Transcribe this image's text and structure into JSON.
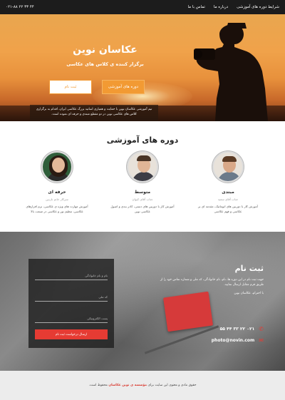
{
  "topbar": {
    "nav": [
      "شرایط دوره های آموزشی",
      "درباره ما",
      "تماس با ما"
    ],
    "phone": "۰۲۱-۸۸ ۲۲ ۳۳ ۴۴"
  },
  "hero": {
    "title": "عکاسان نوین",
    "subtitle": "برگزار کننده ی کلاس های عکاسی",
    "btn_courses": "دوره های آموزشی",
    "btn_register": "ثبت نام",
    "description": "تیم آموزشی عکاسان نوین با حمایت و همیاری اساتید بزرگ عکاسی ایران، اقدام به برگزاری کلاس های عکاسی نوین در دو مقطع مبتدی و حرفه ای نموده است."
  },
  "courses": {
    "title": "دوره های آموزشی",
    "items": [
      {
        "level": "مبتدی",
        "teacher": "جناب آقای سعید",
        "desc": "آموزش کار با دوربین های اتوماتیک، مقدمه ای بر عکاسی و فهم عکاسی"
      },
      {
        "level": "متوسط",
        "teacher": "جناب آقای کیوان",
        "desc": "آموزش کار با دوربین های دستی، کادر بندی و اصول عکاسی نوین"
      },
      {
        "level": "حرفه ای",
        "teacher": "سرکار خانم نازنین",
        "desc": "آموزش مهارت های ویژه ی عکاسی، نرم افزارهای عکاسی، تنظیم نور و عکاسی در صنعت بالا"
      }
    ]
  },
  "register": {
    "title": "ثبت نام",
    "text": "جهت ثبت نام در این دوره ها، نام، نام خانوادگی، کد ملی و شماره تماس خود را از طریق فرم مقابل ارسال نمایید.",
    "regards": "با احترام، عکاسان نوین",
    "phone": "۰۲۱ ۲۲ ۳۳ ۴۴ ۵۵",
    "email": "photo@novin.com",
    "form": {
      "name_placeholder": "نام و نام خانوادگی",
      "national_placeholder": "کد ملی",
      "email_placeholder": "پست الکترونیکی",
      "submit": "ارسال درخواست ثبت نام"
    }
  },
  "footer": {
    "text_before": "حقوق مادی و معنوی این سایت برای ",
    "brand": "مؤسسه ی نوین عکاسان",
    "text_after": " محفوظ است."
  }
}
